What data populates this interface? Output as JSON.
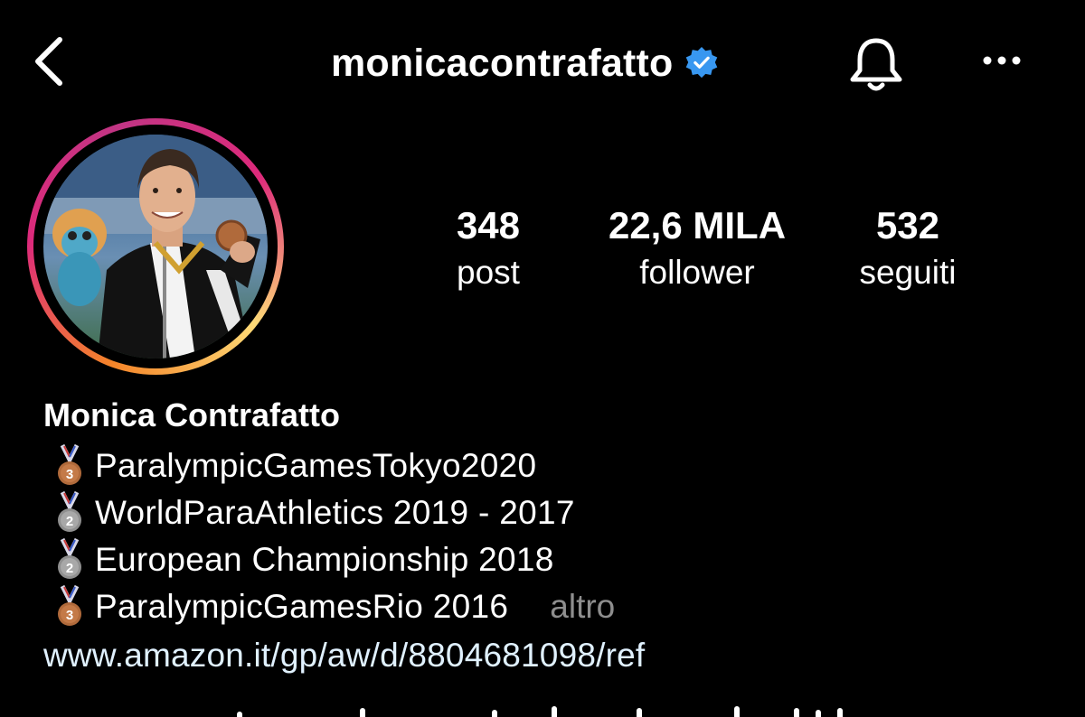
{
  "header": {
    "username": "monicacontrafatto",
    "verified": true,
    "back_icon": "chevron-left-icon",
    "notification_icon": "bell-icon",
    "more_icon": "more-horizontal-icon",
    "verified_color": "#3897f0"
  },
  "profile": {
    "avatar_icon": "profile-photo",
    "story_ring_colors": [
      "#f58529",
      "#dd2a7b",
      "#c13584",
      "#feda77"
    ]
  },
  "stats": [
    {
      "value": "348",
      "label": "post"
    },
    {
      "value": "22,6 MILA",
      "label": "follower"
    },
    {
      "value": "532",
      "label": "seguiti"
    }
  ],
  "bio": {
    "name": "Monica Contrafatto",
    "lines": [
      {
        "medal": "3",
        "medal_color": "#b06a3b",
        "text": "ParalympicGamesTokyo2020"
      },
      {
        "medal": "2",
        "medal_color": "#9e9e9e",
        "text": "WorldParaAthletics 2019 - 2017"
      },
      {
        "medal": "2",
        "medal_color": "#9e9e9e",
        "text": "European Championship 2018"
      },
      {
        "medal": "3",
        "medal_color": "#b06a3b",
        "text": "ParalympicGamesRio 2016"
      }
    ],
    "more_label": "altro",
    "link": "www.amazon.it/gp/aw/d/8804681098/ref"
  }
}
